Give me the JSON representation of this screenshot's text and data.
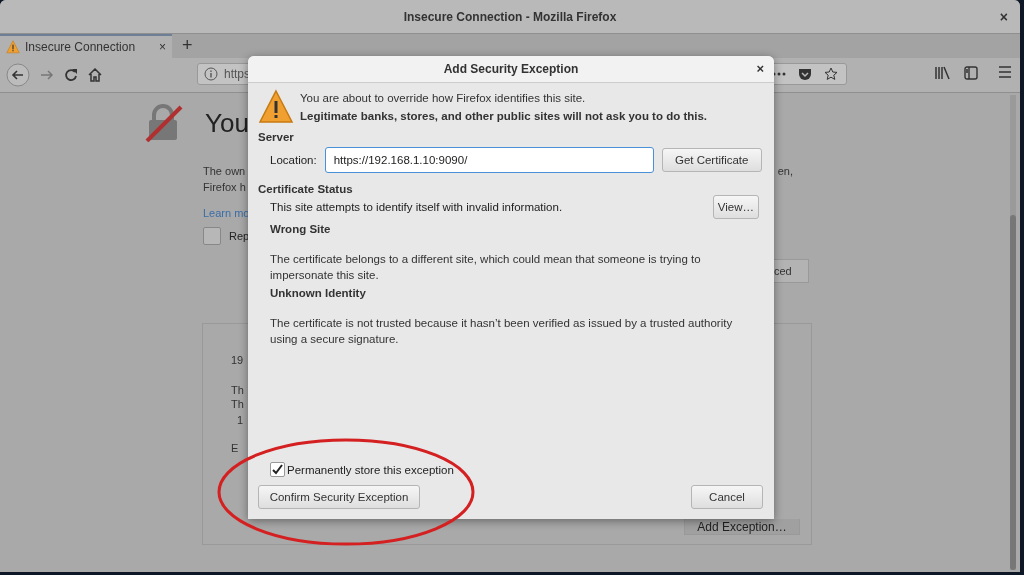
{
  "window": {
    "title": "Insecure Connection - Mozilla Firefox",
    "close": "×"
  },
  "tabs": [
    {
      "label": "Insecure Connection",
      "selected": true,
      "close": "×"
    }
  ],
  "new_tab": "+",
  "url_bar": {
    "value": "https"
  },
  "page": {
    "heading": "You",
    "paragraph_lines": [
      "The own",
      "Firefox h"
    ],
    "paragraph_right": "en,",
    "learn_more": "Learn mo",
    "report_checkbox": {
      "label": "Rep",
      "checked": false
    },
    "advanced_button": "ced",
    "error_lines": [
      "19",
      "Th",
      "Th",
      "1",
      "E"
    ],
    "add_exception_button": "Add Exception…"
  },
  "dialog": {
    "title": "Add Security Exception",
    "close": "×",
    "warning": "You are about to override how Firefox identifies this site.",
    "warning_bold": "Legitimate banks, stores, and other public sites will not ask you to do this.",
    "server_heading": "Server",
    "location_label": "Location:",
    "location_value": "https://192.168.1.10:9090/",
    "get_certificate": "Get Certificate",
    "status_heading": "Certificate Status",
    "status_text": "This site attempts to identify itself with invalid information.",
    "view_button": "View…",
    "problems": [
      {
        "title": "Wrong Site",
        "text": "The certificate belongs to a different site, which could mean that someone is trying to impersonate this site."
      },
      {
        "title": "Unknown Identity",
        "text": "The certificate is not trusted because it hasn’t been verified as issued by a trusted authority using a secure signature."
      }
    ],
    "permanent": {
      "label": "Permanently store this exception",
      "checked": true
    },
    "confirm": "Confirm Security Exception",
    "cancel": "Cancel"
  }
}
